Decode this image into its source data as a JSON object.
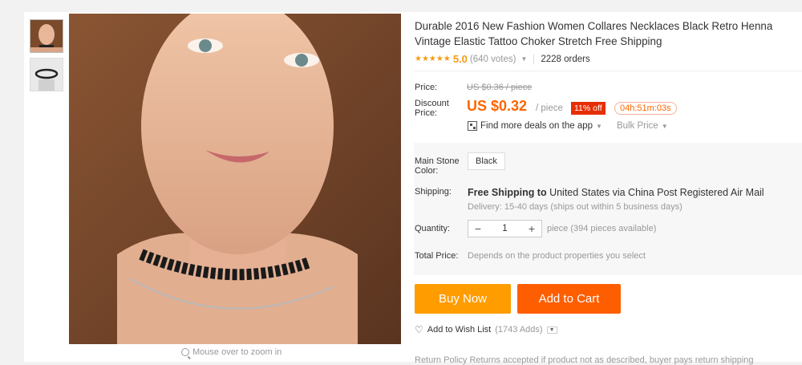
{
  "product": {
    "title": "Durable 2016 New Fashion Women Collares Necklaces Black Retro Henna Vintage Elastic Tattoo Choker Stretch Free Shipping",
    "stars": "★★★★★",
    "score": "5.0",
    "votes": "(640 votes)",
    "orders": "2228 orders"
  },
  "gallery": {
    "zoom_hint": "Mouse over to zoom in"
  },
  "pricing": {
    "price_label": "Price:",
    "old_price": "US $0.36 / piece",
    "discount_label_1": "Discount",
    "discount_label_2": "Price:",
    "price": "US $0.32",
    "per": "/ piece",
    "discount_badge": "11% off",
    "timer": "04h:51m:03s",
    "deals_text": "Find more deals on the app",
    "bulk_price": "Bulk Price"
  },
  "options": {
    "stone_label_1": "Main Stone",
    "stone_label_2": "Color:",
    "stone_value": "Black",
    "shipping_label": "Shipping:",
    "shipping_bold": "Free Shipping to",
    "shipping_rest": " United States via China Post Registered Air Mail",
    "delivery": "Delivery: 15-40 days (ships out within 5 business days)",
    "quantity_label": "Quantity:",
    "quantity_minus": "−",
    "quantity_value": "1",
    "quantity_plus": "+",
    "quantity_note": "piece (394 pieces available)",
    "total_label": "Total Price:",
    "total_note": "Depends on the product properties you select"
  },
  "actions": {
    "buy_now": "Buy Now",
    "add_to_cart": "Add to Cart",
    "wish_list": "Add to Wish List",
    "wish_count": "(1743 Adds)",
    "return_policy": "Return Policy   Returns accepted if product not as described, buyer pays return shipping"
  },
  "colors": {
    "price": "#ff6600",
    "buy_now": "#ff9c00",
    "add_to_cart": "#ff5e00",
    "discount_badge": "#e62e04",
    "stars": "#f39c12"
  }
}
